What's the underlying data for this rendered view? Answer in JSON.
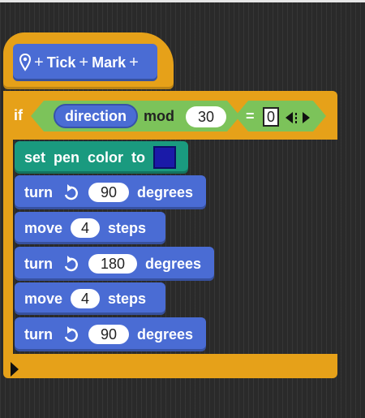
{
  "hat": {
    "proto_parts": [
      "+",
      "Tick",
      "+",
      "Mark",
      "+"
    ]
  },
  "if_block": {
    "label": "if",
    "condition": {
      "variable": "direction",
      "operator": "mod",
      "operand": "30",
      "equals_label": "=",
      "equals_value": "0"
    }
  },
  "statements": [
    {
      "kind": "pen",
      "words": [
        "set",
        "pen",
        "color",
        "to"
      ],
      "color": "#1a1aa8"
    },
    {
      "kind": "turn",
      "label": "turn",
      "value": "90",
      "unit": "degrees"
    },
    {
      "kind": "move",
      "label": "move",
      "value": "4",
      "unit": "steps"
    },
    {
      "kind": "turn",
      "label": "turn",
      "value": "180",
      "unit": "degrees"
    },
    {
      "kind": "move",
      "label": "move",
      "value": "4",
      "unit": "steps"
    },
    {
      "kind": "turn",
      "label": "turn",
      "value": "90",
      "unit": "degrees"
    }
  ],
  "colors": {
    "control": "#e6a119",
    "motion": "#4a6cd4",
    "operators": "#7cc35a",
    "pen": "#1a9a7f"
  }
}
